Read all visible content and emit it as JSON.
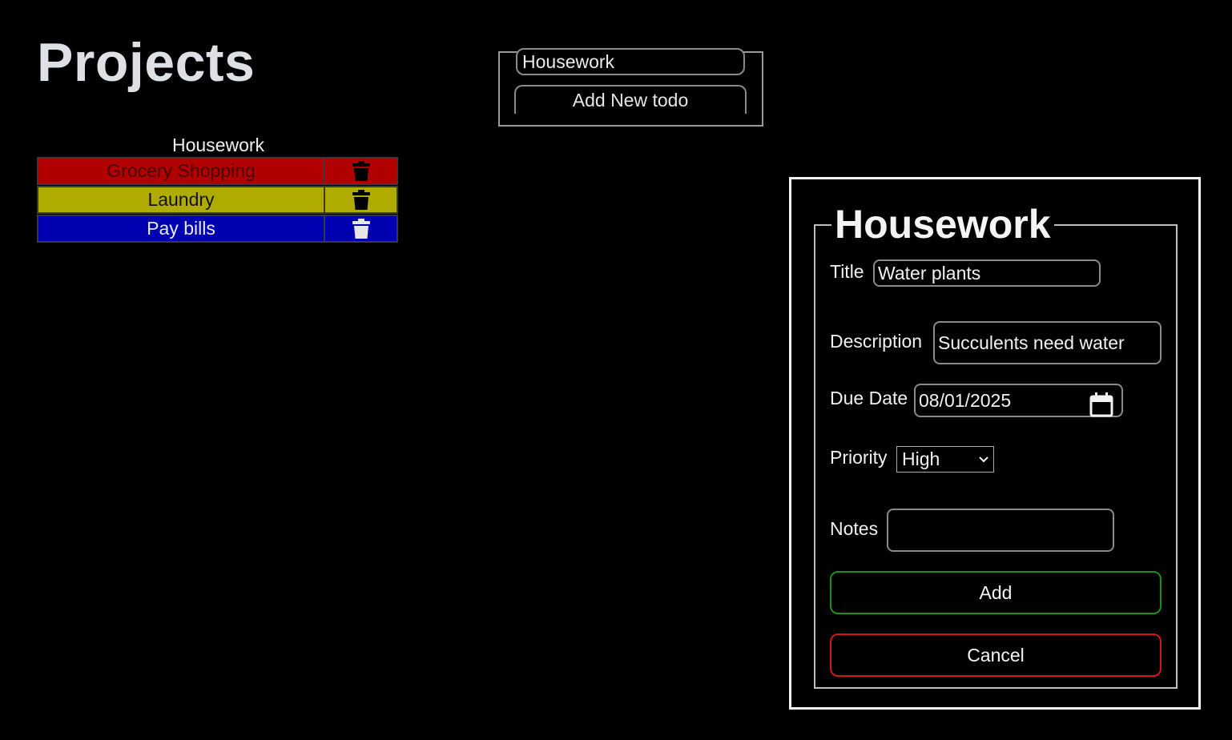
{
  "page": {
    "title": "Projects"
  },
  "projects": {
    "current_name": "Housework",
    "todos": [
      {
        "title": "Grocery Shopping",
        "bg": "#b00000",
        "fg": "#4a0000",
        "icon_color": "#000000"
      },
      {
        "title": "Laundry",
        "bg": "#b0ab00",
        "fg": "#111111",
        "icon_color": "#000000"
      },
      {
        "title": "Pay bills",
        "bg": "#0000b0",
        "fg": "#e8e8ff",
        "icon_color": "#e6e6e6"
      }
    ]
  },
  "new_todo": {
    "project_value": "Housework",
    "add_button": "Add New todo"
  },
  "dialog": {
    "legend": "Housework",
    "title_label": "Title",
    "title_value": "Water plants",
    "description_label": "Description",
    "description_value": "Succulents need water",
    "due_label": "Due Date",
    "due_value": "08/01/2025",
    "priority_label": "Priority",
    "priority_value": "High",
    "notes_label": "Notes",
    "notes_value": "",
    "add_button": "Add",
    "cancel_button": "Cancel",
    "add_border": "#1a8f1a",
    "cancel_border": "#d01818"
  }
}
